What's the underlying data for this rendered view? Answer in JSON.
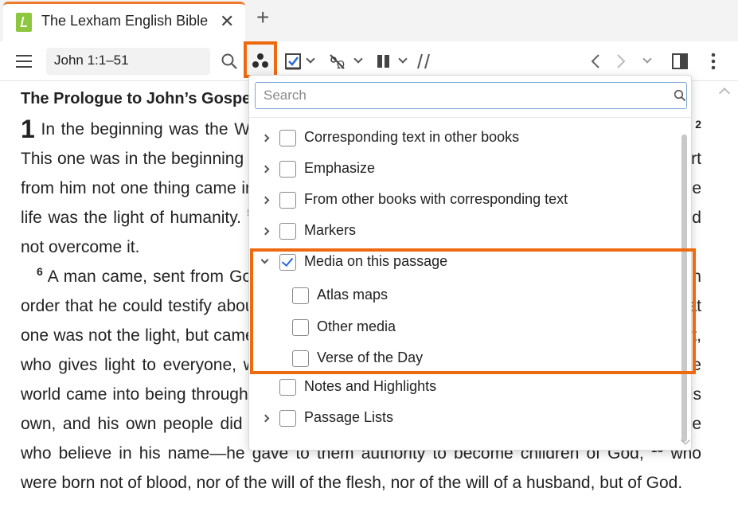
{
  "tab": {
    "title": "The Lexham English Bible",
    "close": "✕",
    "add": "+"
  },
  "toolbar": {
    "reference": "John 1:1–51"
  },
  "bible": {
    "heading": "The Prologue to John’s Gospel",
    "chapter": "1",
    "v1": "In the beginning was the Word, and the Word was with God, and the Word was God.",
    "v2": "This one was in the beginning with God.",
    "v3": "All things came into being through him, and apart from him not one thing came into being that has come into being.",
    "v4": "In him was life, and the life was the light of humanity.",
    "v5": "And the light shines in the darkness, and the darkness did not overcome it.",
    "v6": "A man came, sent from God, whose name was John.",
    "v7": "This one came as a witness, in order that he could testify about the light, in order that all might believe through him.",
    "v8": "That one was not the light, but came in order that he could testify about the light.",
    "v9": "The true light, who gives light to everyone, was coming into the world.",
    "v10": "He was in the world, and the world came into being through him, and the world did not recognize him.",
    "v11": "He came to his own, and his own people did not receive him.",
    "v12": "But as many as received him—to those who believe in his name—he gave to them authority to become children of God,",
    "v13": "who were born not of blood, nor of the will of the flesh, nor of the will of a husband, but of God."
  },
  "dropdown": {
    "search_placeholder": "Search",
    "items": [
      {
        "label": "Corresponding text in other books",
        "checked": false,
        "expandable": true
      },
      {
        "label": "Emphasize",
        "checked": false,
        "expandable": true
      },
      {
        "label": "From other books with corresponding text",
        "checked": false,
        "expandable": true
      },
      {
        "label": "Markers",
        "checked": false,
        "expandable": true
      },
      {
        "label": "Media on this passage",
        "checked": true,
        "expandable": true,
        "expanded": true
      },
      {
        "label": "Atlas maps",
        "checked": false,
        "child": true
      },
      {
        "label": "Other media",
        "checked": false,
        "child": true
      },
      {
        "label": "Verse of the Day",
        "checked": false,
        "child": true
      },
      {
        "label": "Notes and Highlights",
        "checked": false,
        "expandable": false
      },
      {
        "label": "Passage Lists",
        "checked": false,
        "expandable": true
      }
    ]
  },
  "colors": {
    "accent": "#ee6a0e",
    "tab_accent": "#ee7a2d",
    "check": "#2a6ad8",
    "logo": "#8dc63f"
  }
}
